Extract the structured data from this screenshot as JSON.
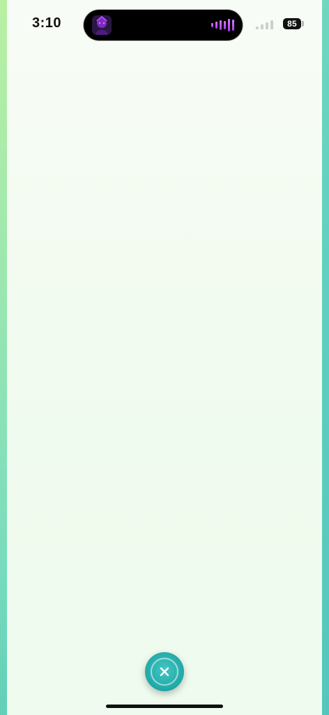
{
  "status_bar": {
    "time": "3:10",
    "battery_percent": "85",
    "signal_bars": 4,
    "signal_bars_active": 0
  },
  "dynamic_island": {
    "app_icon": "purple-character-app-icon",
    "activity_icon": "audio-waveform-icon"
  },
  "main": {
    "background": "#f3fbf1"
  },
  "actions": {
    "close_icon": "close-icon"
  },
  "colors": {
    "accent": "#1fa7a6",
    "edge_top": "#b6f0a6",
    "edge_bottom": "#5bcab8"
  }
}
